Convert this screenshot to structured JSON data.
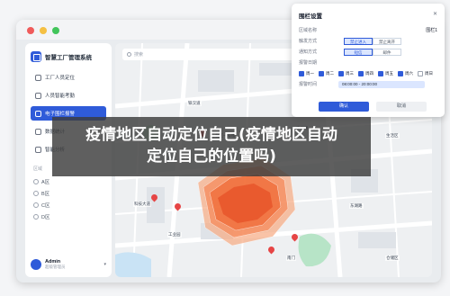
{
  "app": {
    "name": "智慧工厂管理系统"
  },
  "sidebar": {
    "items": [
      {
        "label": "工厂人员定位"
      },
      {
        "label": "人员智能考勤"
      },
      {
        "label": "电子围栏报警"
      },
      {
        "label": "数据统计"
      },
      {
        "label": "智能分析"
      }
    ],
    "areas_title": "区域",
    "areas": [
      "A区",
      "B区",
      "C区",
      "D区"
    ],
    "user": {
      "name": "Admin",
      "role": "超级管理员"
    }
  },
  "map": {
    "search_placeholder": "搜索",
    "labels": [
      "铁汉道",
      "宁和路",
      "科技大道",
      "东湖路",
      "工业园",
      "北区一号楼",
      "南门",
      "生活区",
      "仓储区"
    ]
  },
  "panel": {
    "title": "围栏设置",
    "fields": [
      {
        "label": "区域名称",
        "value": "围栏1"
      },
      {
        "label": "触发方式",
        "options": [
          "禁止进入",
          "禁止离开"
        ],
        "selected": "禁止进入"
      },
      {
        "label": "通知方式",
        "options": [
          "短信",
          "邮件"
        ],
        "selected": "短信"
      },
      {
        "label": "报警日期"
      },
      {
        "label": "报警时间",
        "value": "08:00:00 - 20:00:00"
      }
    ],
    "days": [
      {
        "label": "周一",
        "checked": true
      },
      {
        "label": "周二",
        "checked": true
      },
      {
        "label": "周三",
        "checked": true
      },
      {
        "label": "周四",
        "checked": true
      },
      {
        "label": "周五",
        "checked": true
      },
      {
        "label": "周六",
        "checked": true
      },
      {
        "label": "周日",
        "checked": false
      }
    ],
    "ok": "确认",
    "cancel": "取消"
  },
  "caption": {
    "line1": "疫情地区自动定位自己(疫情地区自动",
    "line2": "定位自己的位置吗)"
  },
  "colors": {
    "accent": "#2f5bd9",
    "fence": "#f05a28",
    "caption_bg": "#3c3c3c"
  }
}
